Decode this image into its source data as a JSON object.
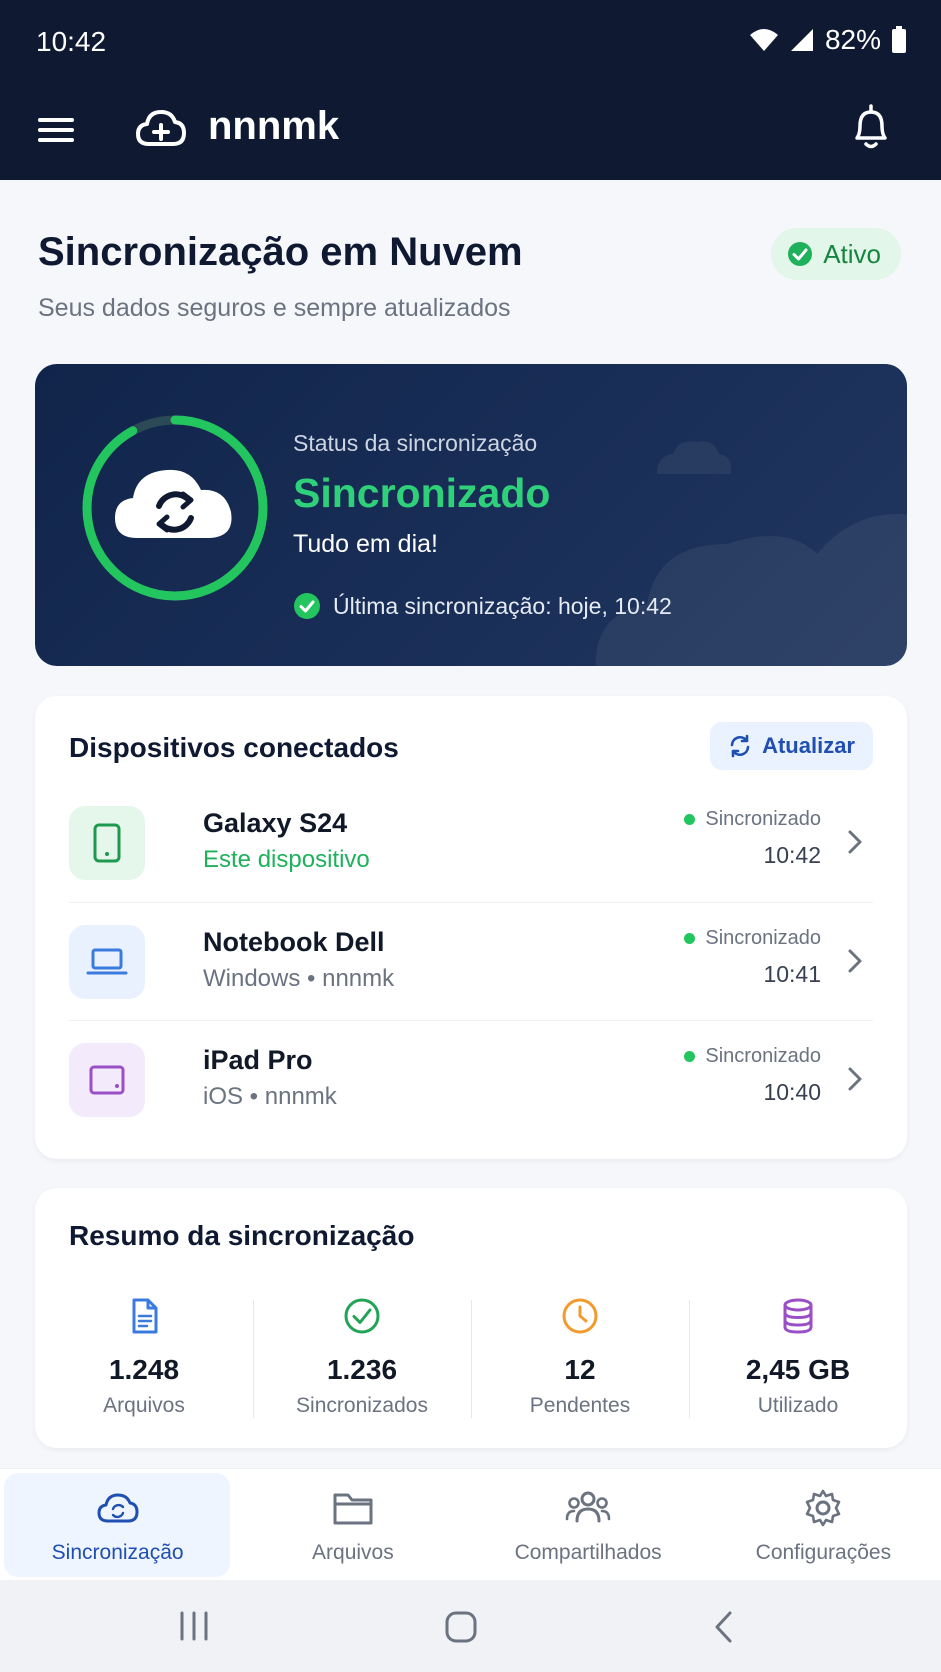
{
  "status_bar": {
    "time": "10:42",
    "battery": "82%"
  },
  "app_bar": {
    "title": "nnnmk"
  },
  "header": {
    "title": "Sincronização em Nuvem",
    "subtitle": "Seus dados seguros e sempre atualizados",
    "badge": "Ativo"
  },
  "sync_status": {
    "label": "Status da sincronização",
    "state": "Sincronizado",
    "message": "Tudo em dia!",
    "last_sync": "Última sincronização: hoje, 10:42",
    "progress": 0.92
  },
  "devices": {
    "title": "Dispositivos conectados",
    "refresh_label": "Atualizar",
    "items": [
      {
        "name": "Galaxy S24",
        "subtitle": "Este dispositivo",
        "status": "Sincronizado",
        "time": "10:42",
        "icon": "smartphone-icon"
      },
      {
        "name": "Notebook Dell",
        "subtitle": "Windows • nnnmk",
        "status": "Sincronizado",
        "time": "10:41",
        "icon": "laptop-icon"
      },
      {
        "name": "iPad Pro",
        "subtitle": "iOS • nnnmk",
        "status": "Sincronizado",
        "time": "10:40",
        "icon": "tablet-icon"
      }
    ]
  },
  "summary": {
    "title": "Resumo da sincronização",
    "stats": [
      {
        "value": "1.248",
        "label": "Arquivos",
        "icon": "file-icon",
        "color": "#3b7be0"
      },
      {
        "value": "1.236",
        "label": "Sincronizados",
        "icon": "check-circle-icon",
        "color": "#22a356"
      },
      {
        "value": "12",
        "label": "Pendentes",
        "icon": "clock-icon",
        "color": "#f29a2e"
      },
      {
        "value": "2,45 GB",
        "label": "Utilizado",
        "icon": "database-icon",
        "color": "#9b4fc7"
      }
    ]
  },
  "bottom_nav": {
    "items": [
      {
        "label": "Sincronização",
        "active": true
      },
      {
        "label": "Arquivos",
        "active": false
      },
      {
        "label": "Compartilhados",
        "active": false
      },
      {
        "label": "Configurações",
        "active": false
      }
    ]
  },
  "colors": {
    "navy": "#0f1a32",
    "green": "#22c55e",
    "blue": "#1f4fb0"
  }
}
